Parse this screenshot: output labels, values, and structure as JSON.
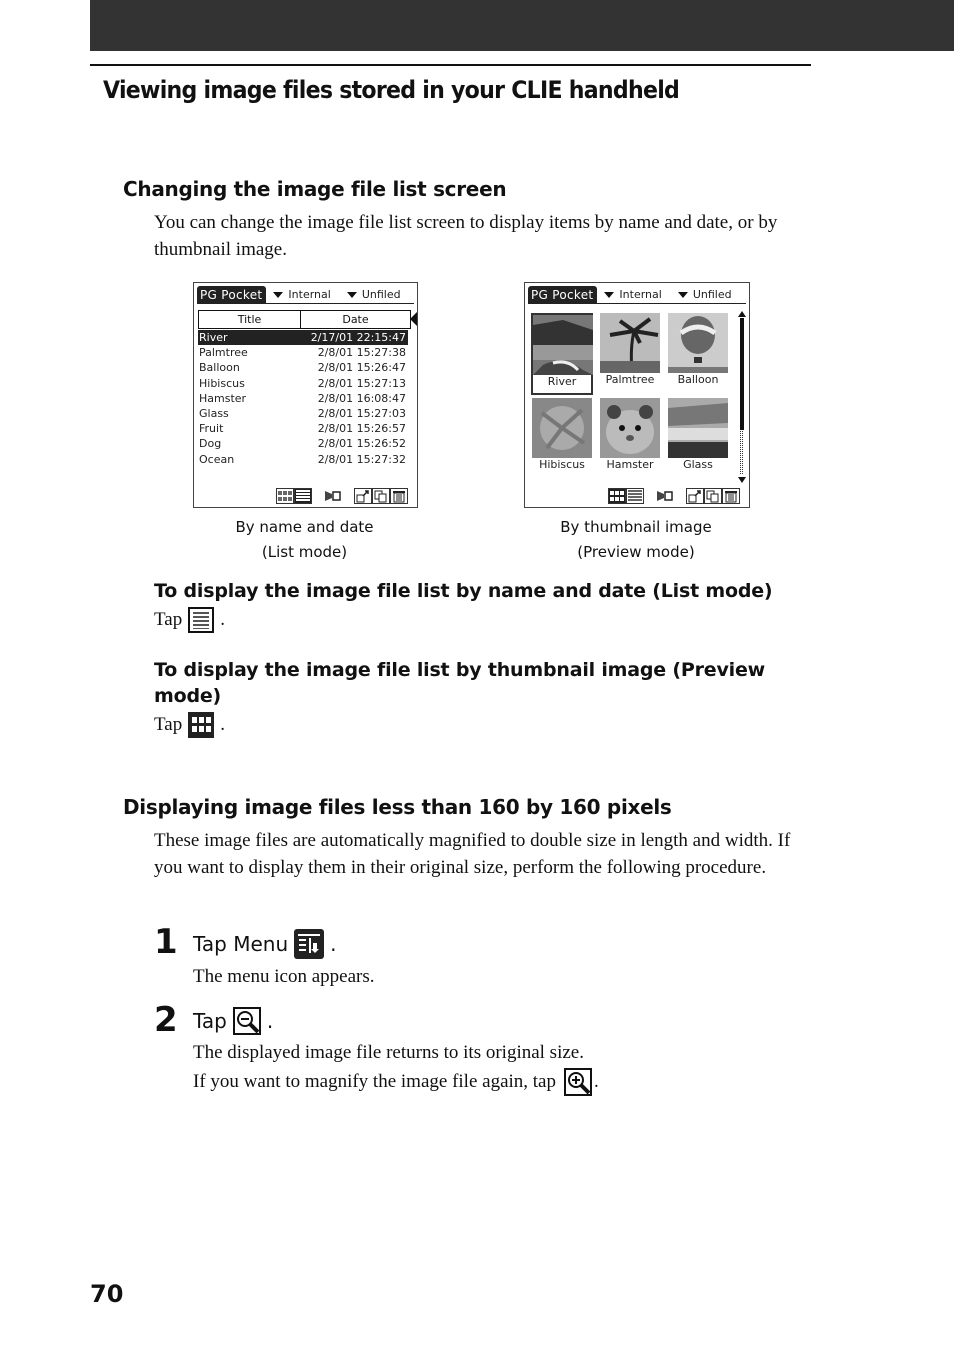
{
  "page": {
    "number": "70",
    "title": "Viewing image files stored in your CLIE handheld"
  },
  "section1": {
    "heading": "Changing the image file list screen",
    "body": "You can change the image file list screen to display items by name and date, or by thumbnail image.",
    "list_screen": {
      "app_title": "PG Pocket",
      "dropdown_1": "Internal",
      "dropdown_2": "Unfiled",
      "columns": [
        "Title",
        "Date"
      ],
      "rows": [
        {
          "title": "River",
          "date": "2/17/01 22:15:47",
          "selected": true
        },
        {
          "title": "Palmtree",
          "date": "2/8/01 15:27:38"
        },
        {
          "title": "Balloon",
          "date": "2/8/01 15:26:47"
        },
        {
          "title": "Hibiscus",
          "date": "2/8/01 15:27:13"
        },
        {
          "title": "Hamster",
          "date": "2/8/01 16:08:47"
        },
        {
          "title": "Glass",
          "date": "2/8/01 15:27:03"
        },
        {
          "title": "Fruit",
          "date": "2/8/01 15:26:57"
        },
        {
          "title": "Dog",
          "date": "2/8/01 15:26:52"
        },
        {
          "title": "Ocean",
          "date": "2/8/01 15:27:32"
        }
      ],
      "caption_line1": "By name and date",
      "caption_line2": "(List mode)"
    },
    "preview_screen": {
      "app_title": "PG Pocket",
      "dropdown_1": "Internal",
      "dropdown_2": "Unfiled",
      "thumbnails": [
        {
          "label": "River",
          "selected": true
        },
        {
          "label": "Palmtree"
        },
        {
          "label": "Balloon"
        },
        {
          "label": "Hibiscus"
        },
        {
          "label": "Hamster"
        },
        {
          "label": "Glass"
        }
      ],
      "caption_line1": "By thumbnail image",
      "caption_line2": "(Preview mode)"
    },
    "list_mode": {
      "heading": "To display the image file list by name and date (List mode)",
      "tap": "Tap",
      "icon": "list-view-icon",
      "end": "."
    },
    "preview_mode": {
      "heading": "To display the image file list by thumbnail image (Preview mode)",
      "tap": "Tap",
      "icon": "thumbnail-view-icon",
      "end": "."
    }
  },
  "section2": {
    "heading": "Displaying image files less than 160 by 160 pixels",
    "body": "These image files are automatically magnified to double size in length and width. If you want to display them in their original size, perform the following procedure.",
    "steps": [
      {
        "number": "1",
        "title": "Tap Menu",
        "icon": "menu-icon",
        "end": ".",
        "body": "The menu icon appears."
      },
      {
        "number": "2",
        "title": "Tap",
        "icon": "zoom-out-icon",
        "end": ".",
        "body_line1": "The displayed image file returns to its original size.",
        "body_line2": "If you want to magnify the image file again, tap",
        "body_line2_icon": "zoom-in-icon",
        "body_line2_end": "."
      }
    ]
  }
}
